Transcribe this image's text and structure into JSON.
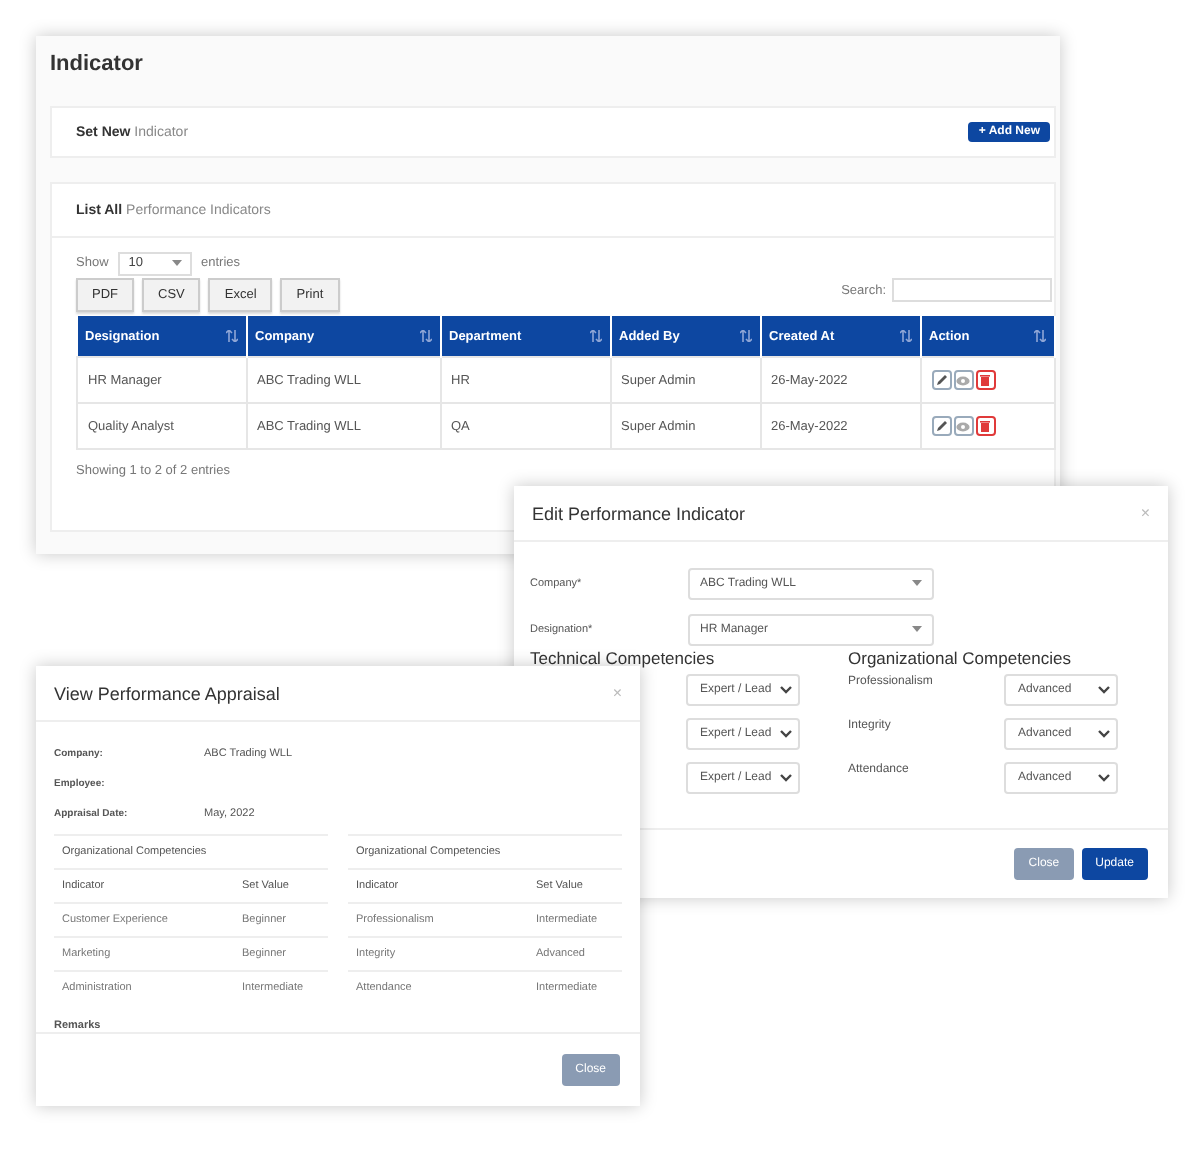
{
  "page": {
    "title": "Indicator",
    "set_new": "**Set New** Indicator",
    "add_button": "+ Add New",
    "list_title": "**List All** Performance Indicators",
    "length": {
      "show": "Show",
      "value": "10",
      "entries": "entries"
    },
    "export_buttons": [
      "PDF",
      "CSV",
      "Excel",
      "Print"
    ],
    "search_label": "Search:",
    "table": {
      "columns": [
        "Designation",
        "Company",
        "Department",
        "Added By",
        "Created At",
        "Action"
      ],
      "rows": [
        {
          "cells": [
            "HR Manager",
            "ABC Trading WLL",
            "HR",
            "Super Admin",
            "26-May-2022"
          ]
        },
        {
          "cells": [
            "Quality Analyst",
            "ABC Trading WLL",
            "QA",
            "Super Admin",
            "26-May-2022"
          ]
        }
      ]
    },
    "info": "Showing 1 to 2 of 2 entries"
  },
  "edit_modal": {
    "title": "Edit Performance Indicator",
    "close": "×",
    "fields": [
      {
        "label": "Company*",
        "value": "ABC Trading WLL"
      },
      {
        "label": "Designation*",
        "value": "HR Manager"
      }
    ],
    "technical": {
      "heading": "Technical Competencies",
      "values": [
        "Expert / Lead",
        "Expert / Lead",
        "Expert / Lead"
      ]
    },
    "organizational": {
      "heading": "Organizational Competencies",
      "items": [
        {
          "label": "Professionalism",
          "value": "Advanced"
        },
        {
          "label": "Integrity",
          "value": "Advanced"
        },
        {
          "label": "Attendance",
          "value": "Advanced"
        }
      ]
    },
    "buttons": [
      {
        "label": "Close",
        "kind": "secondary"
      },
      {
        "label": "Update",
        "kind": "primary"
      }
    ]
  },
  "view_modal": {
    "title": "View Performance Appraisal",
    "close": "×",
    "fields": [
      {
        "label": "Company:",
        "value": "ABC Trading WLL"
      },
      {
        "label": "Employee:"
      },
      {
        "label": "Appraisal Date:",
        "value": "May, 2022"
      }
    ],
    "tables": [
      {
        "heading": "Organizational Competencies",
        "columns": [
          "Indicator",
          "Set Value"
        ],
        "rows": [
          [
            "Customer Experience",
            "Beginner"
          ],
          [
            "Marketing",
            "Beginner"
          ],
          [
            "Administration",
            "Intermediate"
          ]
        ]
      },
      {
        "heading": "Organizational Competencies",
        "columns": [
          "Indicator",
          "Set Value"
        ],
        "rows": [
          [
            "Professionalism",
            "Intermediate"
          ],
          [
            "Integrity",
            "Advanced"
          ],
          [
            "Attendance",
            "Intermediate"
          ]
        ]
      }
    ],
    "remarks_label": "Remarks",
    "button": "Close"
  }
}
